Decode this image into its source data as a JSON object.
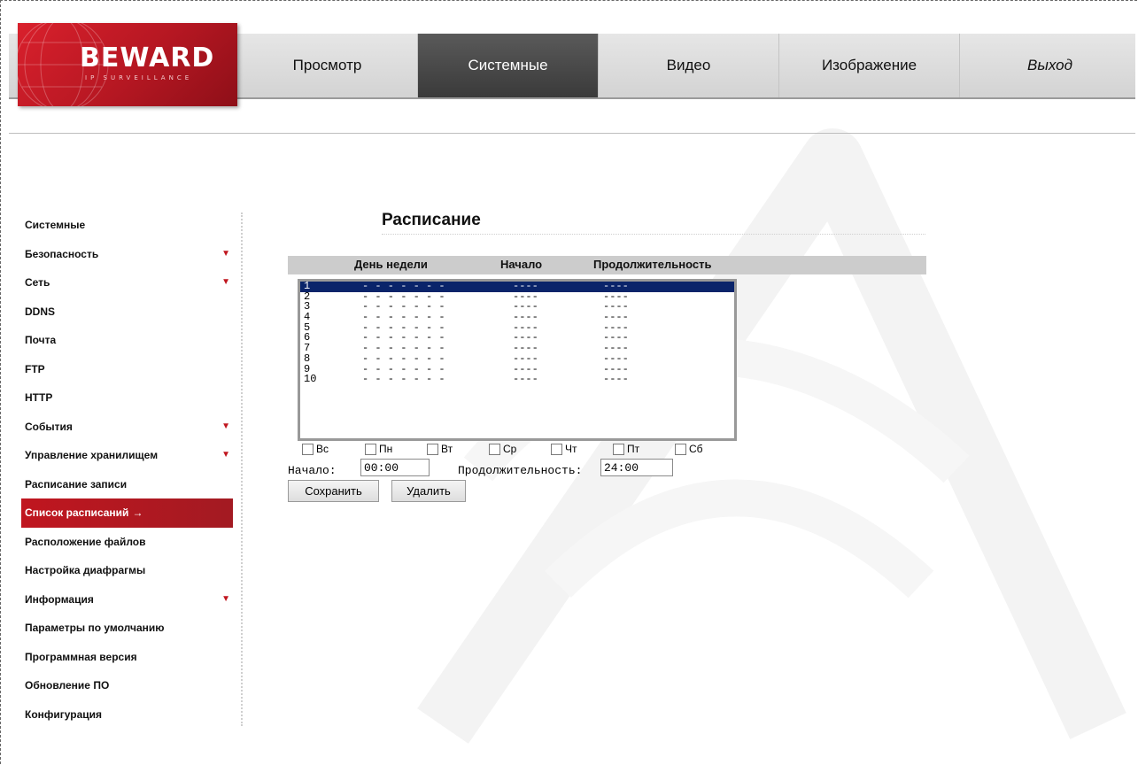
{
  "brand": {
    "logo_text": "BEWARD",
    "logo_subtitle": "IP SURVEILLANCE",
    "brand_color": "#c0161f"
  },
  "nav": {
    "items": [
      {
        "label": "Просмотр"
      },
      {
        "label": "Системные"
      },
      {
        "label": "Видео"
      },
      {
        "label": "Изображение"
      },
      {
        "label": "Выход"
      }
    ],
    "active_index": 1
  },
  "sidebar": {
    "items": [
      {
        "label": "Системные",
        "expandable": false
      },
      {
        "label": "Безопасность",
        "expandable": true
      },
      {
        "label": "Сеть",
        "expandable": true
      },
      {
        "label": "DDNS",
        "expandable": false
      },
      {
        "label": "Почта",
        "expandable": false
      },
      {
        "label": "FTP",
        "expandable": false
      },
      {
        "label": "HTTP",
        "expandable": false
      },
      {
        "label": "События",
        "expandable": true
      },
      {
        "label": "Управление хранилищем",
        "expandable": true
      },
      {
        "label": "Расписание записи",
        "expandable": false
      },
      {
        "label": "Список расписаний",
        "expandable": false,
        "active": true,
        "trail": "→"
      },
      {
        "label": "Расположение файлов",
        "expandable": false
      },
      {
        "label": "Настройка диафрагмы",
        "expandable": false
      },
      {
        "label": "Информация",
        "expandable": true
      },
      {
        "label": "Параметры по умолчанию",
        "expandable": false
      },
      {
        "label": "Программная версия",
        "expandable": false
      },
      {
        "label": "Обновление ПО",
        "expandable": false
      },
      {
        "label": "Конфигурация",
        "expandable": false
      }
    ],
    "expand_icon": "triangle-down-icon"
  },
  "main": {
    "title": "Расписание",
    "columns": [
      "День недели",
      "Начало",
      "Продолжительность"
    ],
    "rows": [
      {
        "num": "1",
        "days": "- - - - - - -",
        "start": "----",
        "duration": "----"
      },
      {
        "num": "2",
        "days": "- - - - - - -",
        "start": "----",
        "duration": "----"
      },
      {
        "num": "3",
        "days": "- - - - - - -",
        "start": "----",
        "duration": "----"
      },
      {
        "num": "4",
        "days": "- - - - - - -",
        "start": "----",
        "duration": "----"
      },
      {
        "num": "5",
        "days": "- - - - - - -",
        "start": "----",
        "duration": "----"
      },
      {
        "num": "6",
        "days": "- - - - - - -",
        "start": "----",
        "duration": "----"
      },
      {
        "num": "7",
        "days": "- - - - - - -",
        "start": "----",
        "duration": "----"
      },
      {
        "num": "8",
        "days": "- - - - - - -",
        "start": "----",
        "duration": "----"
      },
      {
        "num": "9",
        "days": "- - - - - - -",
        "start": "----",
        "duration": "----"
      },
      {
        "num": "10",
        "days": "- - - - - - -",
        "start": "----",
        "duration": "----"
      }
    ],
    "selected_row": 0,
    "weekdays": [
      "Вс",
      "Пн",
      "Вт",
      "Ср",
      "Чт",
      "Пт",
      "Сб"
    ],
    "start_label": "Начало:",
    "start_value": "00:00",
    "duration_label": "Продолжительность:",
    "duration_value": "24:00",
    "save_label": "Сохранить",
    "delete_label": "Удалить"
  }
}
